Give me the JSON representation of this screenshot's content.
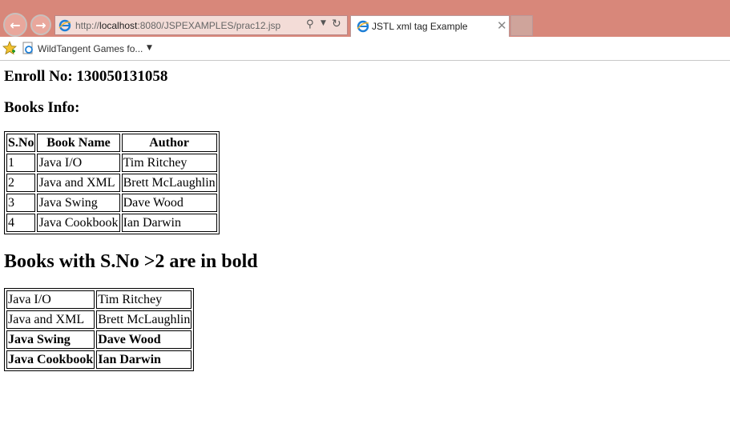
{
  "browser": {
    "url_prefix": "http://",
    "url_host": "localhost",
    "url_rest": ":8080/JSPEXAMPLES/prac12.jsp",
    "tab_title": "JSTL xml tag Example",
    "favorites_item": "WildTangent Games fo...",
    "titlebar_color": "#d8877a"
  },
  "page": {
    "enroll": "Enroll No: 130050131058",
    "books_info_heading": "Books Info:",
    "table1": {
      "headers": [
        "S.No",
        "Book Name",
        "Author"
      ],
      "rows": [
        [
          "1",
          "Java I/O",
          "Tim Ritchey"
        ],
        [
          "2",
          "Java and XML",
          "Brett McLaughlin"
        ],
        [
          "3",
          "Java Swing",
          "Dave Wood"
        ],
        [
          "4",
          "Java Cookbook",
          "Ian Darwin"
        ]
      ]
    },
    "bold_heading": "Books with S.No >2 are in bold",
    "table2": {
      "rows": [
        [
          "Java I/O",
          "Tim Ritchey"
        ],
        [
          "Java and XML",
          "Brett McLaughlin"
        ],
        [
          "Java Swing",
          "Dave Wood"
        ],
        [
          "Java Cookbook",
          "Ian Darwin"
        ]
      ]
    }
  }
}
